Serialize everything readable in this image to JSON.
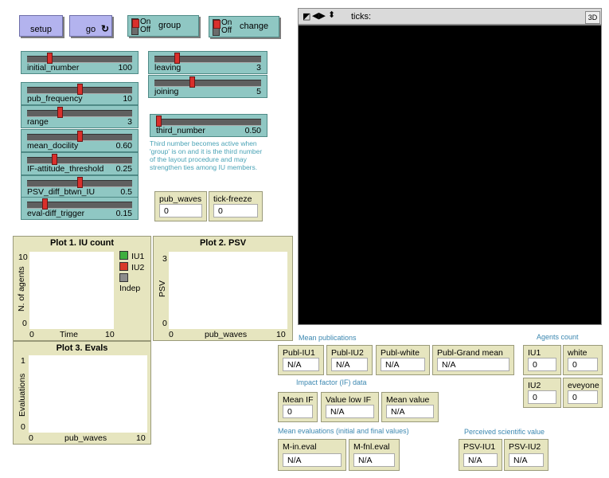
{
  "buttons": {
    "setup": "setup",
    "go": "go"
  },
  "switches": {
    "group": {
      "on": "On",
      "off": "Off",
      "label": "group"
    },
    "change": {
      "on": "On",
      "off": "Off",
      "label": "change"
    }
  },
  "sliders": {
    "initial_number": {
      "label": "initial_number",
      "value": "100"
    },
    "leaving": {
      "label": "leaving",
      "value": "3"
    },
    "joining": {
      "label": "joining",
      "value": "5"
    },
    "pub_frequency": {
      "label": "pub_frequency",
      "value": "10"
    },
    "range": {
      "label": "range",
      "value": "3"
    },
    "third_number": {
      "label": "third_number",
      "value": "0.50"
    },
    "mean_docility": {
      "label": "mean_docility",
      "value": "0.60"
    },
    "if_attitude_threshold": {
      "label": "IF-attitude_threshold",
      "value": "0.25"
    },
    "psv_diff_btwn_iu": {
      "label": "PSV_diff_btwn_IU",
      "value": "0.5"
    },
    "eval_diff_trigger": {
      "label": "eval-diff_trigger",
      "value": "0.15"
    }
  },
  "third_number_note": [
    "Third number becomes active when",
    "'group' is on and it is the third number",
    "of the layout procedure and may",
    "strengthen ties among IU members."
  ],
  "monitors": {
    "pub_waves": {
      "label": "pub_waves",
      "value": "0"
    },
    "tick_freeze": {
      "label": "tick-freeze",
      "value": "0"
    },
    "publ_iu1": {
      "label": "Publ-IU1",
      "value": "N/A"
    },
    "publ_iu2": {
      "label": "Publ-IU2",
      "value": "N/A"
    },
    "publ_white": {
      "label": "Publ-white",
      "value": "N/A"
    },
    "publ_grand_mean": {
      "label": "Publ-Grand mean",
      "value": "N/A"
    },
    "iu1": {
      "label": "IU1",
      "value": "0"
    },
    "white": {
      "label": "white",
      "value": "0"
    },
    "iu2": {
      "label": "IU2",
      "value": "0"
    },
    "eveyone": {
      "label": "eveyone",
      "value": "0"
    },
    "mean_if": {
      "label": "Mean IF",
      "value": "0"
    },
    "value_low_if": {
      "label": "Value low IF",
      "value": "N/A"
    },
    "mean_value": {
      "label": "Mean value",
      "value": "N/A"
    },
    "m_in_eval": {
      "label": "M-in.eval",
      "value": "N/A"
    },
    "m_fnl_eval": {
      "label": "M-fnl.eval",
      "value": "N/A"
    },
    "psv_iu1": {
      "label": "PSV-IU1",
      "value": "N/A"
    },
    "psv_iu2": {
      "label": "PSV-IU2",
      "value": "N/A"
    }
  },
  "sections": {
    "mean_publications": "Mean publications",
    "agents_count": "Agents count",
    "impact_factor": "Impact factor (IF) data",
    "mean_evaluations": "Mean evaluations (initial and final values)",
    "perceived_value": "Perceived scientific value"
  },
  "plots": {
    "plot1": {
      "title": "Plot 1. IU count",
      "ylabel": "N. of agents",
      "xlabel": "Time",
      "xmin": "0",
      "xmax": "10",
      "ymin": "0",
      "ymax": "10",
      "legend": [
        {
          "name": "IU1",
          "color": "#3fae3f"
        },
        {
          "name": "IU2",
          "color": "#d83a2c"
        },
        {
          "name": "Indep",
          "color": "#8c8c8c"
        }
      ]
    },
    "plot2": {
      "title": "Plot 2. PSV",
      "ylabel": "PSV",
      "xlabel": "pub_waves",
      "xmin": "0",
      "xmax": "10",
      "ymin": "0",
      "ymax": "3"
    },
    "plot3": {
      "title": "Plot 3. Evals",
      "ylabel": "Evaluations",
      "xlabel": "pub_waves",
      "xmin": "0",
      "xmax": "10",
      "ymin": "0",
      "ymax": "1"
    }
  },
  "view": {
    "ticks_label": "ticks:",
    "three_d": "3D"
  },
  "slider_fractions": {
    "initial_number": 0.2,
    "leaving": 0.2,
    "joining": 0.35,
    "pub_frequency": 0.5,
    "range": 0.3,
    "third_number": 0.0,
    "mean_docility": 0.5,
    "if_attitude_threshold": 0.25,
    "psv_diff_btwn_iu": 0.5,
    "eval_diff_trigger": 0.15
  }
}
